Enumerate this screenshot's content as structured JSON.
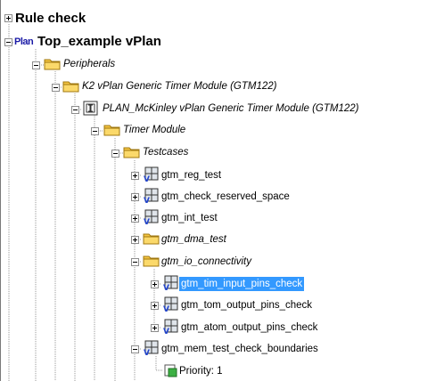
{
  "tree": {
    "rule_check": {
      "label": "Rule check"
    },
    "top": {
      "label": "Top_example    vPlan",
      "icon_text": "Plan"
    },
    "peripherals": {
      "label": "Peripherals"
    },
    "k2": {
      "label": "K2 vPlan Generic Timer Module (GTM122)"
    },
    "plan_mckinley": {
      "label": "PLAN_McKinley vPlan Generic Timer Module (GTM122)"
    },
    "timer_module": {
      "label": "Timer Module"
    },
    "testcases": {
      "label": "Testcases"
    },
    "items": [
      {
        "label": "gtm_reg_test"
      },
      {
        "label": "gtm_check_reserved_space"
      },
      {
        "label": "gtm_int_test"
      },
      {
        "label": "gtm_dma_test"
      },
      {
        "label": "gtm_io_connectivity"
      },
      {
        "label": "gtm_tim_input_pins_check"
      },
      {
        "label": "gtm_tom_output_pins_check"
      },
      {
        "label": "gtm_atom_output_pins_check"
      },
      {
        "label": "gtm_mem_test_check_boundaries"
      },
      {
        "label": "Priority: 1"
      }
    ]
  },
  "colors": {
    "selection": "#3399ff",
    "folder": "#f5c542",
    "priority": "#3cb043"
  }
}
